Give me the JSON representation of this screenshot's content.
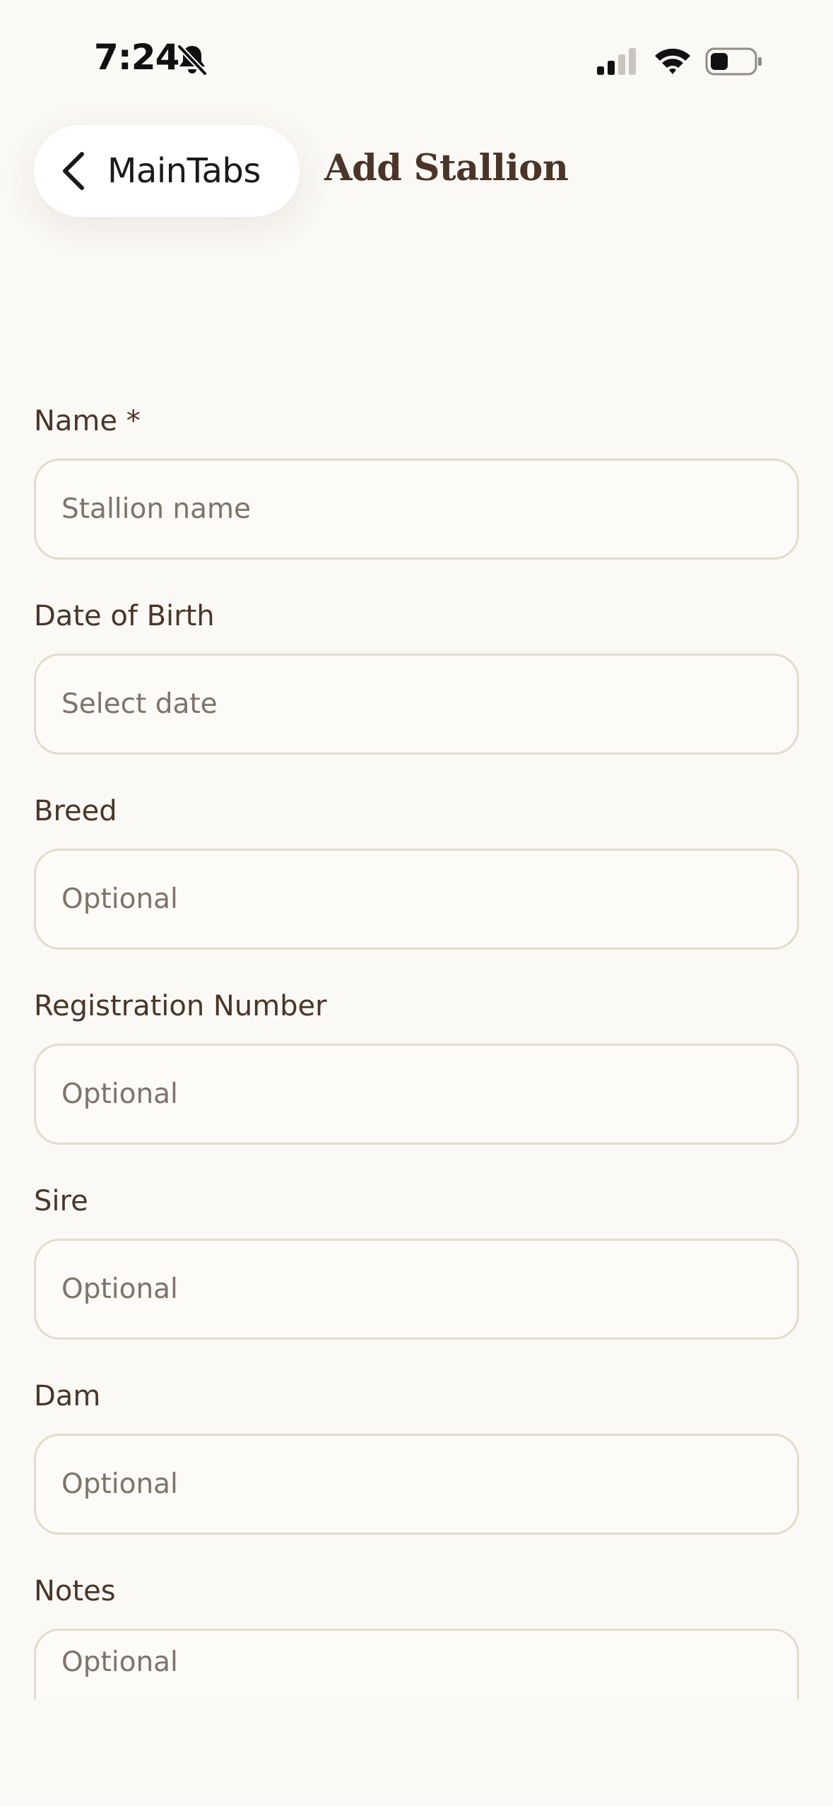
{
  "status_bar": {
    "time": "7:24",
    "icons": [
      "bell-off-icon",
      "cellular-signal-icon",
      "wifi-icon",
      "battery-icon"
    ]
  },
  "header": {
    "back_label": "MainTabs",
    "title": "Add Stallion"
  },
  "form": {
    "fields": [
      {
        "label": "Name *",
        "placeholder": "Stallion name",
        "value": ""
      },
      {
        "label": "Date of Birth",
        "placeholder": "Select date",
        "value": ""
      },
      {
        "label": "Breed",
        "placeholder": "Optional",
        "value": ""
      },
      {
        "label": "Registration Number",
        "placeholder": "Optional",
        "value": ""
      },
      {
        "label": "Sire",
        "placeholder": "Optional",
        "value": ""
      },
      {
        "label": "Dam",
        "placeholder": "Optional",
        "value": ""
      },
      {
        "label": "Notes",
        "placeholder": "Optional",
        "value": ""
      }
    ]
  },
  "colors": {
    "background": "#fbf9f5",
    "text": "#4a3528",
    "placeholder": "#7e736b",
    "input_border": "#e2dccd"
  }
}
